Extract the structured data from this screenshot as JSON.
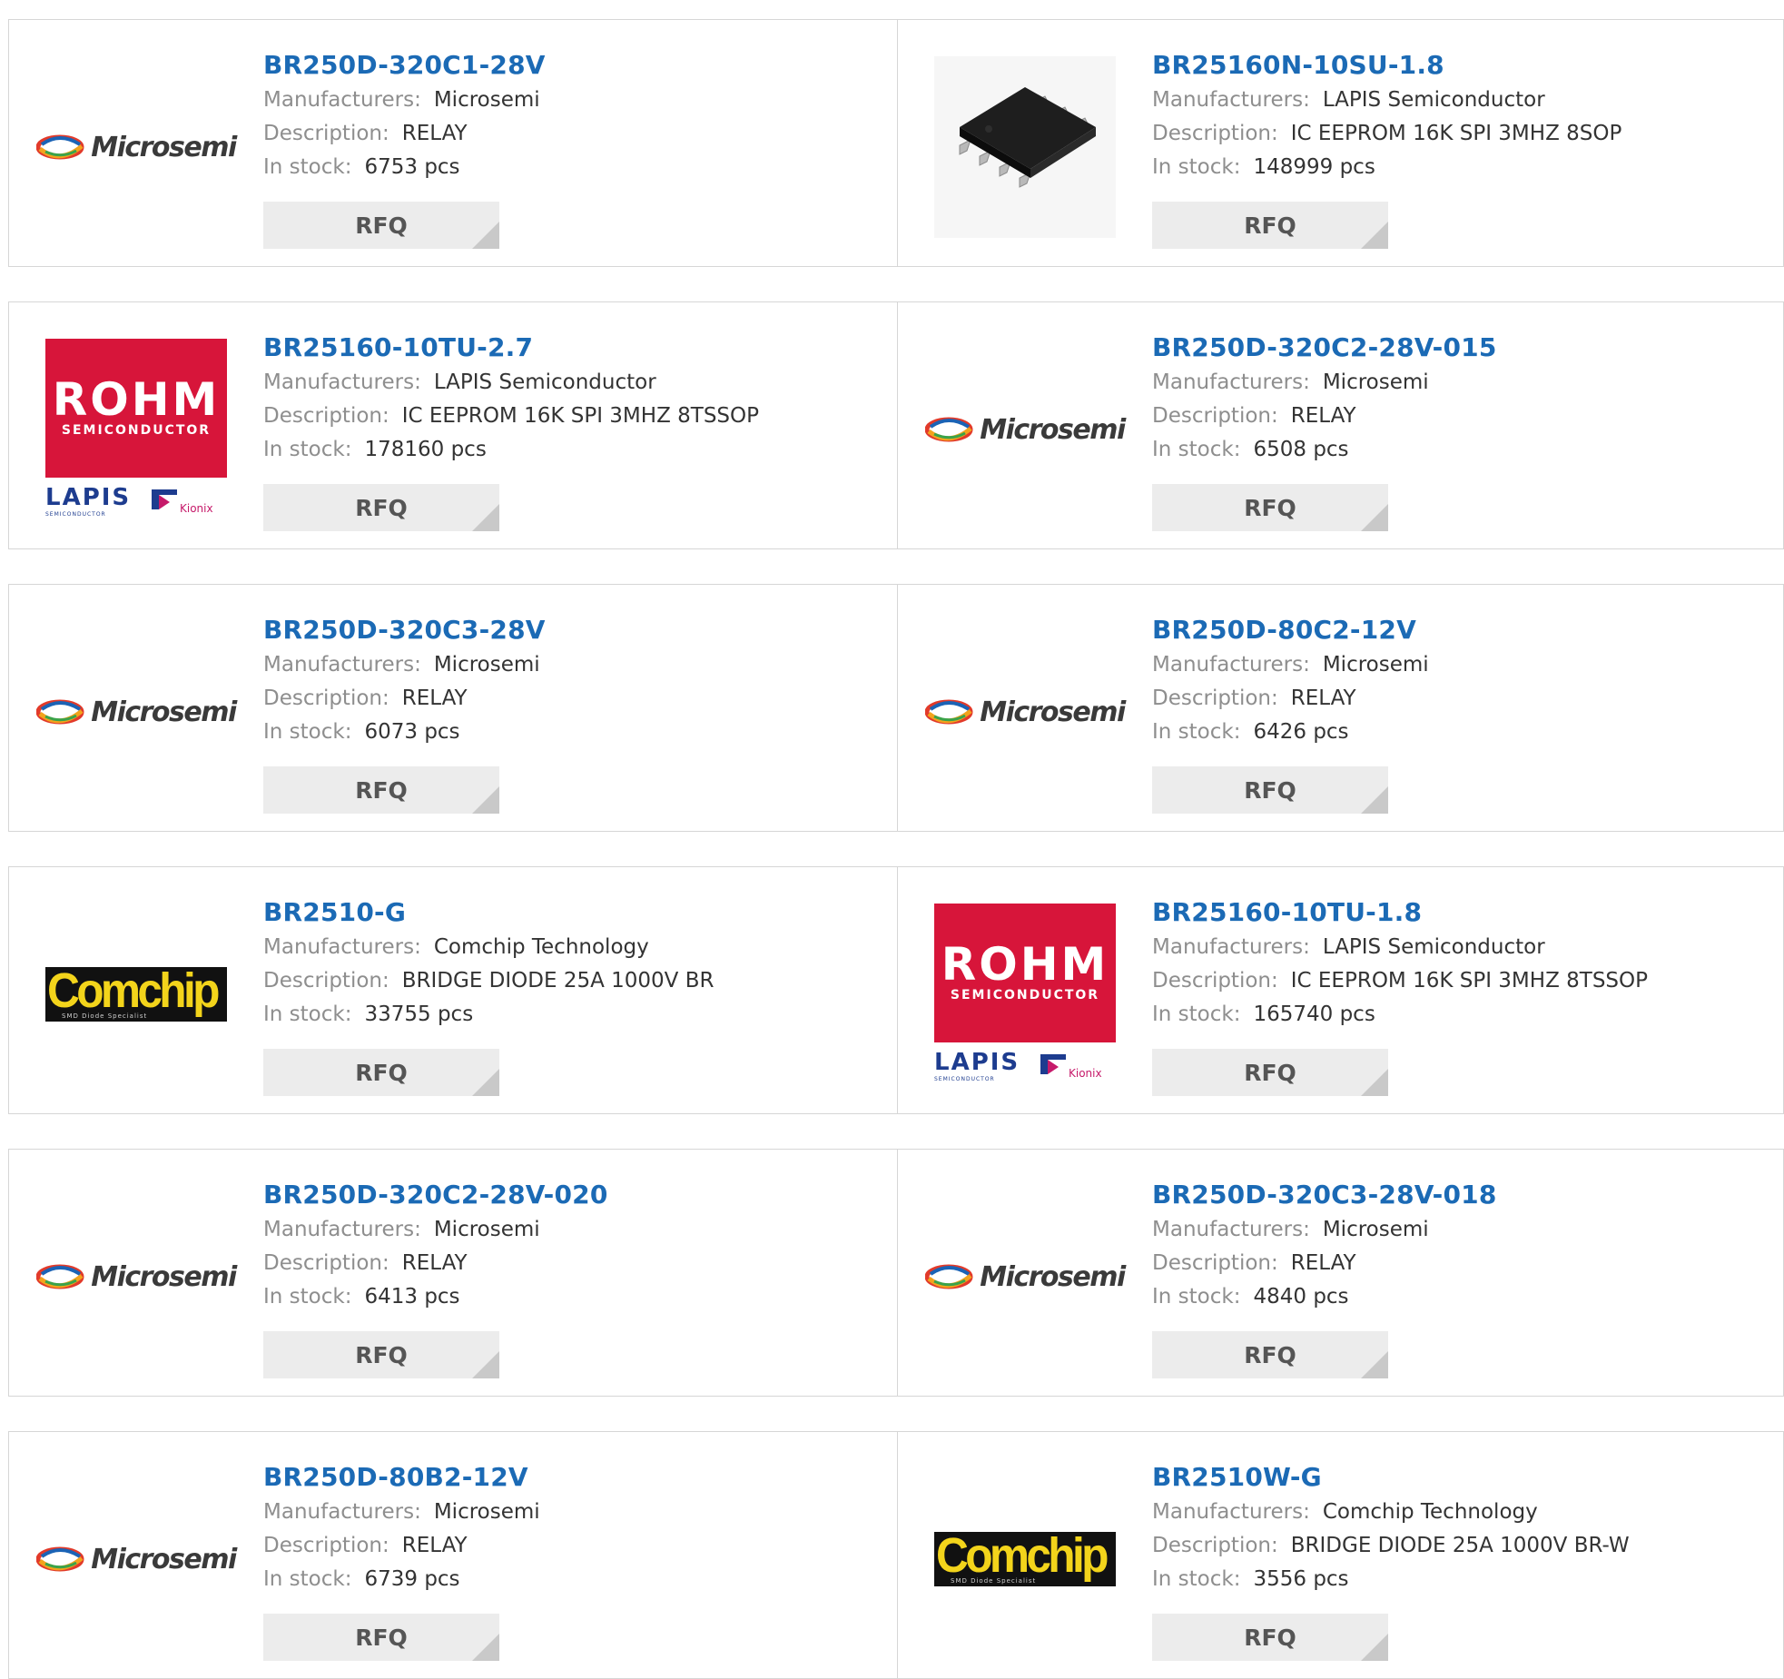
{
  "labels": {
    "manufacturers": "Manufacturers:",
    "description": "Description:",
    "in_stock": "In stock:",
    "rfq": "RFQ"
  },
  "logos": {
    "microsemi": "Microsemi",
    "rohm": "ROHM",
    "rohm_sub": "SEMICONDUCTOR",
    "lapis": "LAPIS",
    "lapis_sub": "SEMICONDUCTOR",
    "kionix": "Kionix",
    "comchip": "Comchip",
    "comchip_sub": "SMD Diode Specialist"
  },
  "colors": {
    "title": "#1b6ab5",
    "rohm_red": "#d7153a",
    "comchip_yellow": "#f3d41b"
  },
  "rows": [
    [
      {
        "part": "BR250D-320C1-28V",
        "manufacturer": "Microsemi",
        "description": "RELAY",
        "stock": "6753 pcs",
        "logo": "microsemi"
      },
      {
        "part": "BR25160N-10SU-1.8",
        "manufacturer": "LAPIS Semiconductor",
        "description": "IC EEPROM 16K SPI 3MHZ 8SOP",
        "stock": "148999 pcs",
        "logo": "chip"
      }
    ],
    [
      {
        "part": "BR25160-10TU-2.7",
        "manufacturer": "LAPIS Semiconductor",
        "description": "IC EEPROM 16K SPI 3MHZ 8TSSOP",
        "stock": "178160 pcs",
        "logo": "rohm"
      },
      {
        "part": "BR250D-320C2-28V-015",
        "manufacturer": "Microsemi",
        "description": "RELAY",
        "stock": "6508 pcs",
        "logo": "microsemi"
      }
    ],
    [
      {
        "part": "BR250D-320C3-28V",
        "manufacturer": "Microsemi",
        "description": "RELAY",
        "stock": "6073 pcs",
        "logo": "microsemi"
      },
      {
        "part": "BR250D-80C2-12V",
        "manufacturer": "Microsemi",
        "description": "RELAY",
        "stock": "6426 pcs",
        "logo": "microsemi"
      }
    ],
    [
      {
        "part": "BR2510-G",
        "manufacturer": "Comchip Technology",
        "description": "BRIDGE DIODE 25A 1000V BR",
        "stock": "33755 pcs",
        "logo": "comchip"
      },
      {
        "part": "BR25160-10TU-1.8",
        "manufacturer": "LAPIS Semiconductor",
        "description": "IC EEPROM 16K SPI 3MHZ 8TSSOP",
        "stock": "165740 pcs",
        "logo": "rohm"
      }
    ],
    [
      {
        "part": "BR250D-320C2-28V-020",
        "manufacturer": "Microsemi",
        "description": "RELAY",
        "stock": "6413 pcs",
        "logo": "microsemi"
      },
      {
        "part": "BR250D-320C3-28V-018",
        "manufacturer": "Microsemi",
        "description": "RELAY",
        "stock": "4840 pcs",
        "logo": "microsemi"
      }
    ],
    [
      {
        "part": "BR250D-80B2-12V",
        "manufacturer": "Microsemi",
        "description": "RELAY",
        "stock": "6739 pcs",
        "logo": "microsemi"
      },
      {
        "part": "BR2510W-G",
        "manufacturer": "Comchip Technology",
        "description": "BRIDGE DIODE 25A 1000V BR-W",
        "stock": "3556 pcs",
        "logo": "comchip"
      }
    ]
  ]
}
